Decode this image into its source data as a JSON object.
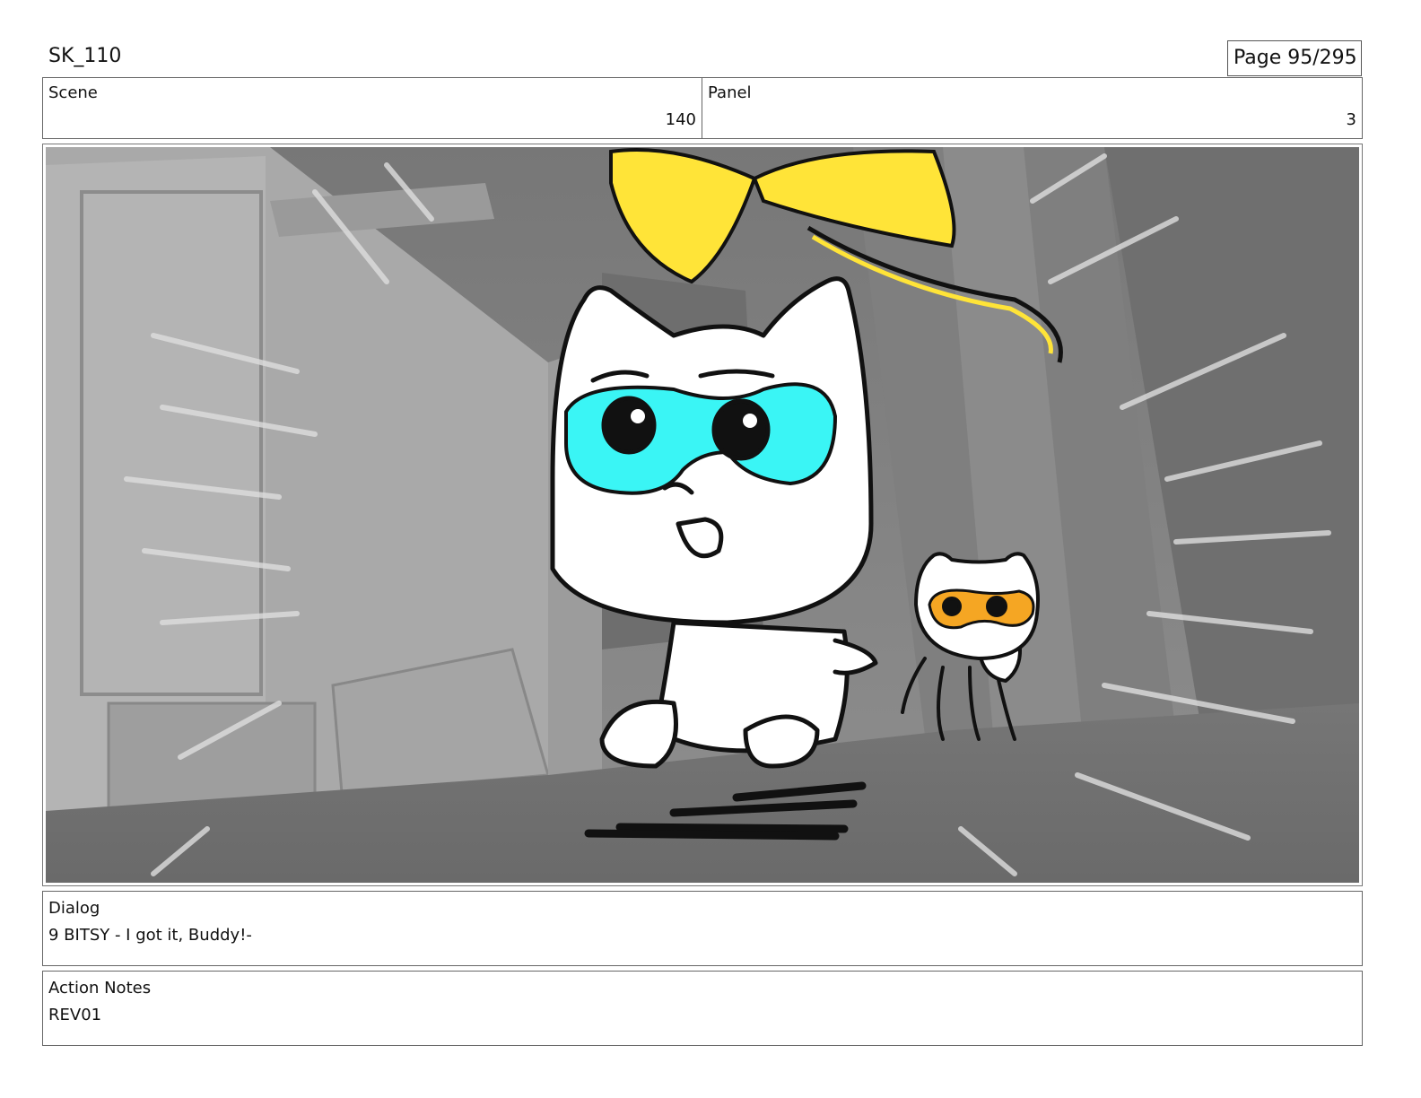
{
  "header": {
    "project_title": "SK_110",
    "page_label": "Page 95/295"
  },
  "scene": {
    "label": "Scene",
    "value": "140"
  },
  "panel": {
    "label": "Panel",
    "value": "3"
  },
  "illustration": {
    "colors": {
      "bitsy_mask": "#3af5f5",
      "buddy_mask": "#f5a623",
      "balloon": "#ffe438",
      "background": "#8c8c8c"
    }
  },
  "dialog": {
    "label": "Dialog",
    "text": "9 BITSY - I got it, Buddy!-"
  },
  "action_notes": {
    "label": "Action Notes",
    "text": "REV01"
  }
}
